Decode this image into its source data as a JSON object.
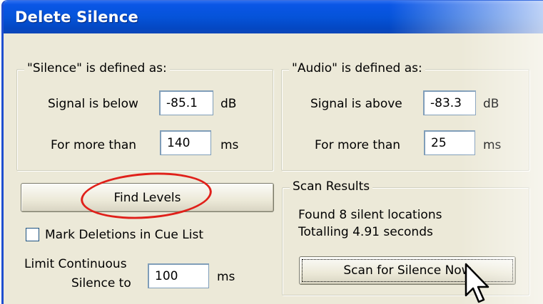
{
  "window": {
    "title": "Delete Silence"
  },
  "silence_group": {
    "legend": "\"Silence\" is defined as:",
    "signal_label": "Signal is below",
    "signal_value": "-85.1",
    "signal_unit": "dB",
    "duration_label": "For more than",
    "duration_value": "140",
    "duration_unit": "ms"
  },
  "audio_group": {
    "legend": "\"Audio\" is defined as:",
    "signal_label": "Signal is above",
    "signal_value": "-83.3",
    "signal_unit": "dB",
    "duration_label": "For more than",
    "duration_value": "25",
    "duration_unit": "ms"
  },
  "find_levels_button": {
    "label": "Find Levels"
  },
  "mark_deletions": {
    "label": "Mark Deletions in Cue List",
    "checked": false
  },
  "limit": {
    "label_line1": "Limit Continuous",
    "label_line2": "Silence to",
    "value": "100",
    "unit": "ms"
  },
  "scan_results": {
    "legend": "Scan Results",
    "line1": "Found 8 silent locations",
    "line2": "Totalling 4.91 seconds",
    "scan_button": "Scan for Silence Now"
  },
  "annotation": {
    "highlight_color": "#e0201a"
  },
  "colors": {
    "titlebar": "#0553d9",
    "dialog": "#ece9d8"
  }
}
